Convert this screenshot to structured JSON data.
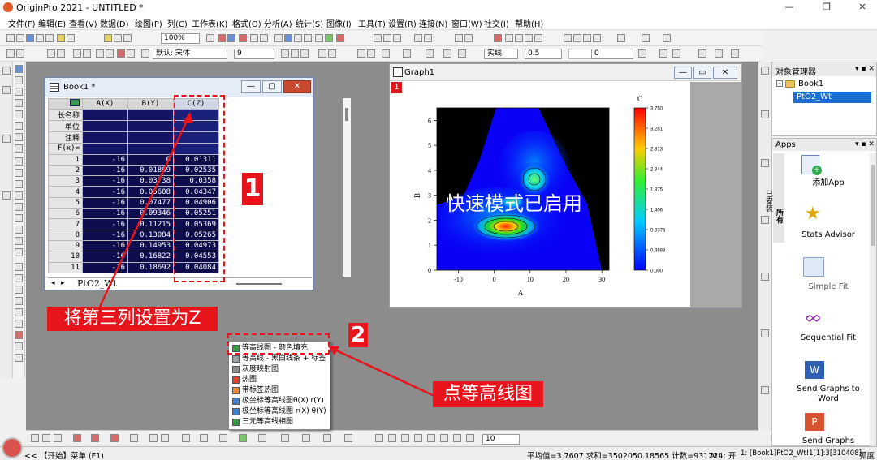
{
  "app": {
    "title": "OriginPro 2021 - UNTITLED *",
    "window_buttons": [
      "—",
      "❐",
      "✕"
    ]
  },
  "menu": [
    "文件(F)",
    "编辑(E)",
    "查看(V)",
    "数据(D)",
    "绘图(P)",
    "列(C)",
    "工作表(K)",
    "格式(O)",
    "分析(A)",
    "统计(S)",
    "图像(I)",
    "工具(T)",
    "设置(R)",
    "连接(N)",
    "窗口(W)",
    "社交(I)",
    "帮助(H)"
  ],
  "toolbar": {
    "zoom": "100%",
    "font_name": "默认: 宋体",
    "font_size": "9",
    "line_style": "实线",
    "line_width": "0.5",
    "zero": "0",
    "bottom_size": "10"
  },
  "book": {
    "title": "Book1 *",
    "columns": [
      "A(X)",
      "B(Y)",
      "C(Z)"
    ],
    "meta_rows": [
      "长名称",
      "单位",
      "注释",
      "F(x)="
    ],
    "rows": [
      {
        "n": "1",
        "a": "-16",
        "b": "0",
        "c": "0.01311"
      },
      {
        "n": "2",
        "a": "-16",
        "b": "0.01869",
        "c": "0.02535"
      },
      {
        "n": "3",
        "a": "-16",
        "b": "0.03738",
        "c": "0.0358"
      },
      {
        "n": "4",
        "a": "-16",
        "b": "0.05608",
        "c": "0.04347"
      },
      {
        "n": "5",
        "a": "-16",
        "b": "0.07477",
        "c": "0.04906"
      },
      {
        "n": "6",
        "a": "-16",
        "b": "0.09346",
        "c": "0.05251"
      },
      {
        "n": "7",
        "a": "-16",
        "b": "0.11215",
        "c": "0.05369"
      },
      {
        "n": "8",
        "a": "-16",
        "b": "0.13084",
        "c": "0.05265"
      },
      {
        "n": "9",
        "a": "-16",
        "b": "0.14953",
        "c": "0.04973"
      },
      {
        "n": "10",
        "a": "-16",
        "b": "0.16822",
        "c": "0.04553"
      },
      {
        "n": "11",
        "a": "-16",
        "b": "0.18692",
        "c": "0.04084"
      }
    ],
    "sheet_tab": "PtO2_Wt"
  },
  "graph": {
    "title": "Graph1",
    "layer_label": "1",
    "overlay_text": "快速模式已启用",
    "xlabel": "A",
    "ylabel": "B",
    "zlabel": "C",
    "xticks": [
      "-10",
      "0",
      "10",
      "20",
      "30"
    ],
    "yticks": [
      "0",
      "1",
      "2",
      "3",
      "4",
      "5",
      "6"
    ],
    "scale_ticks": [
      "3.750",
      "3.281",
      "2.813",
      "2.344",
      "1.875",
      "1.406",
      "0.9375",
      "0.4688",
      "0.000"
    ]
  },
  "object_manager": {
    "title": "对象管理器",
    "book": "Book1",
    "sheet": "PtO2_Wt"
  },
  "apps": {
    "title": "Apps",
    "side_tabs": [
      "所有",
      "已安装"
    ],
    "items": [
      "添加App",
      "Stats Advisor",
      "Simple Fit",
      "Sequential Fit",
      "Send Graphs to Word",
      "Send Graphs"
    ]
  },
  "popup": {
    "items": [
      "等高线图 - 颜色填充",
      "等高线 - 黑白线条 + 标签",
      "灰度映射图",
      "热图",
      "带标签热图",
      "极坐标等高线图θ(X) r(Y)",
      "极坐标等高线图 r(X) θ(Y)",
      "三元等高线相图"
    ],
    "icon_colors": [
      "#2e9e3e",
      "#9aa0a6",
      "#8b8b8b",
      "#e0402f",
      "#e88a2a",
      "#3f7fd0",
      "#3f7fd0",
      "#2e9e3e"
    ]
  },
  "annotations": {
    "label1": "1",
    "label2": "2",
    "text1": "将第三列设置为Z",
    "text2": "点等高线图"
  },
  "status": {
    "start": "<< 【开始】菜单 (F1)",
    "stats": "平均值=3.7607 求和=3502050.18565 计数=931224",
    "au": "AU : 开",
    "cell": "1: [Book1]PtO2_Wt!1[1]:3[310408]",
    "unit": "弧度"
  }
}
